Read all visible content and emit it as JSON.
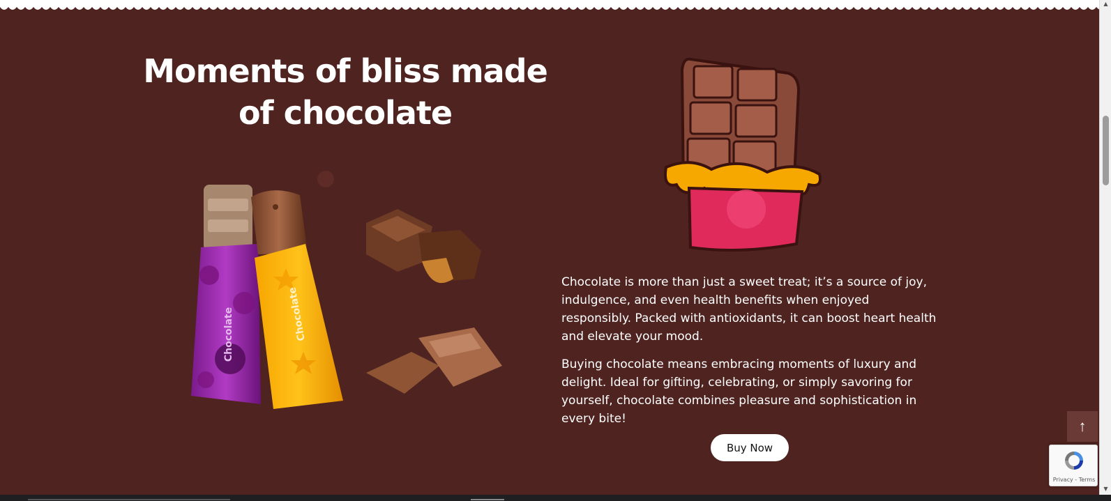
{
  "section": {
    "headline_line1": "Moments of bliss made",
    "headline_line2": "of chocolate",
    "paragraph1": "Chocolate is more than just a sweet treat; it’s a source of joy, indulgence, and even health benefits when enjoyed responsibly. Packed with antioxidants, it can boost heart health and elevate your mood.",
    "paragraph2": "Buying chocolate means embracing moments of luxury and delight. Ideal for gifting, celebrating, or simply savoring for yourself, chocolate combines pleasure and sophistication in every bite!",
    "cta_label": "Buy Now",
    "wrapper_text_purple": "Chocolate",
    "wrapper_text_yellow": "Chocolate"
  },
  "widgets": {
    "back_to_top_icon": "arrow-up-icon",
    "recaptcha_links": "Privacy - Terms"
  },
  "colors": {
    "background": "#4e2320",
    "text": "#ffffff",
    "button_bg": "#ffffff"
  }
}
